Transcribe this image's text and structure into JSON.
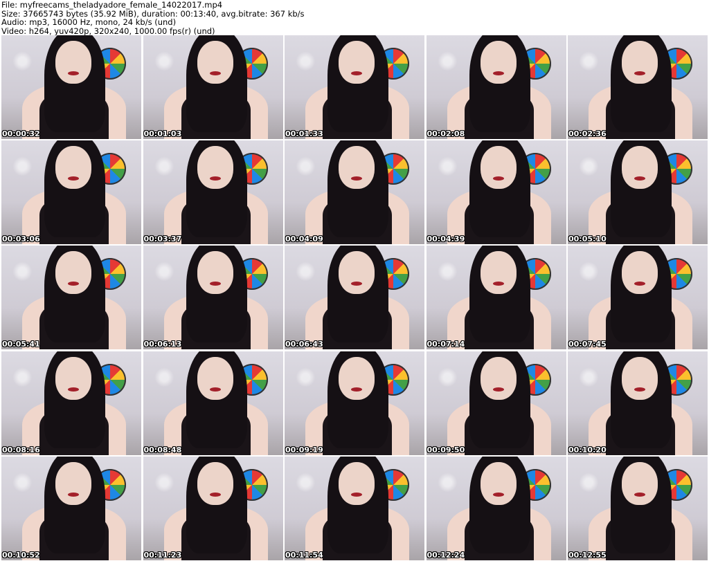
{
  "header": {
    "line1": "File: myfreecams_theladyadore_female_14022017.mp4",
    "line2": "Size: 37665743 bytes (35.92 MiB), duration: 00:13:40, avg.bitrate: 367 kb/s",
    "line3": "Audio: mp3, 16000 Hz, mono, 24 kb/s (und)",
    "line4": "Video: h264, yuv420p, 320x240, 1000.00 fps(r) (und)"
  },
  "thumbnails": [
    {
      "timestamp": "00:00:32"
    },
    {
      "timestamp": "00:01:03"
    },
    {
      "timestamp": "00:01:33"
    },
    {
      "timestamp": "00:02:08"
    },
    {
      "timestamp": "00:02:36"
    },
    {
      "timestamp": "00:03:06"
    },
    {
      "timestamp": "00:03:37"
    },
    {
      "timestamp": "00:04:09"
    },
    {
      "timestamp": "00:04:39"
    },
    {
      "timestamp": "00:05:10"
    },
    {
      "timestamp": "00:05:41"
    },
    {
      "timestamp": "00:06:13"
    },
    {
      "timestamp": "00:06:43"
    },
    {
      "timestamp": "00:07:14"
    },
    {
      "timestamp": "00:07:45"
    },
    {
      "timestamp": "00:08:16"
    },
    {
      "timestamp": "00:08:48"
    },
    {
      "timestamp": "00:09:19"
    },
    {
      "timestamp": "00:09:50"
    },
    {
      "timestamp": "00:10:20"
    },
    {
      "timestamp": "00:10:52"
    },
    {
      "timestamp": "00:11:23"
    },
    {
      "timestamp": "00:11:54"
    },
    {
      "timestamp": "00:12:24"
    },
    {
      "timestamp": "00:12:55"
    }
  ]
}
